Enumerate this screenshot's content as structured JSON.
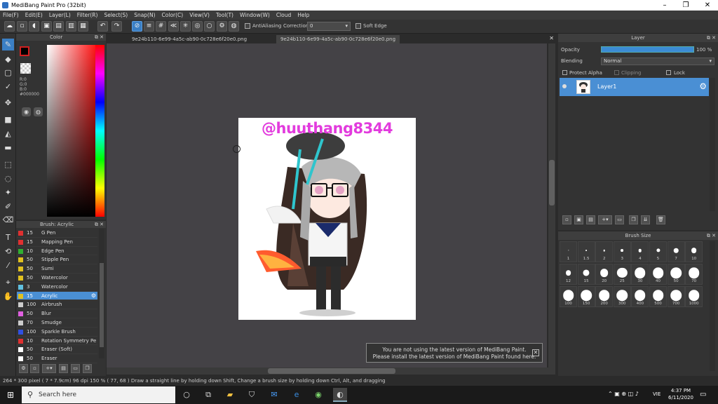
{
  "window": {
    "title": "MediBang Paint Pro (32bit)"
  },
  "menu": [
    "File(F)",
    "Edit(E)",
    "Layer(L)",
    "Filter(R)",
    "Select(S)",
    "Snap(N)",
    "Color(C)",
    "View(V)",
    "Tool(T)",
    "Window(W)",
    "Cloud",
    "Help"
  ],
  "toolbar": {
    "antialiasing": "AntiAliasing",
    "correction": "Correction",
    "correction_value": "0",
    "soft_edge": "Soft Edge"
  },
  "color_panel": {
    "title": "Color",
    "rgb": "R:0\nG:0\nB:0\n#000000",
    "fg_color": "#000000"
  },
  "brush_panel": {
    "title": "Brush: Acrylic",
    "items": [
      {
        "size": "15",
        "name": "G Pen",
        "color": "#e03030"
      },
      {
        "size": "15",
        "name": "Mapping Pen",
        "color": "#e03030"
      },
      {
        "size": "10",
        "name": "Edge Pen",
        "color": "#30b030"
      },
      {
        "size": "50",
        "name": "Stipple Pen",
        "color": "#e0c020"
      },
      {
        "size": "50",
        "name": "Sumi",
        "color": "#e0c020"
      },
      {
        "size": "50",
        "name": "Watercolor",
        "color": "#e0c020"
      },
      {
        "size": "3",
        "name": "Watercolor",
        "color": "#60c0e0"
      },
      {
        "size": "15",
        "name": "Acrylic",
        "color": "#e0c020",
        "selected": true
      },
      {
        "size": "100",
        "name": "Airbrush",
        "color": "#cccccc"
      },
      {
        "size": "50",
        "name": "Blur",
        "color": "#e060e0"
      },
      {
        "size": "70",
        "name": "Smudge",
        "color": "#cccccc"
      },
      {
        "size": "100",
        "name": "Sparkle Brush",
        "color": "#3050e0"
      },
      {
        "size": "10",
        "name": "Rotation Symmetry Pe",
        "color": "#e03030"
      },
      {
        "size": "50",
        "name": "Eraser (Soft)",
        "color": "#ffffff"
      },
      {
        "size": "50",
        "name": "Eraser",
        "color": "#ffffff"
      }
    ]
  },
  "tabs": [
    "9e24b110-6e99-4a5c-ab90-0c728e6f20e0.png",
    "9e24b110-6e99-4a5c-ab90-0c728e6f20e0.png"
  ],
  "canvas": {
    "watermark": "@huuthang8344"
  },
  "notice": {
    "line1": "You are not using the latest version of MediBang Paint.",
    "line2": "Please install the latest version of MediBang Paint found here."
  },
  "layer_panel": {
    "title": "Layer",
    "opacity_label": "Opacity",
    "opacity_value": "100 %",
    "opacity": 1.0,
    "blending_label": "Blending",
    "blending_value": "Normal",
    "protect_alpha": "Protect Alpha",
    "clipping": "Clipping",
    "lock": "Lock",
    "layer_name": "Layer1"
  },
  "brush_size": {
    "title": "Brush Size",
    "sizes": [
      "1",
      "1.5",
      "2",
      "3",
      "4",
      "5",
      "7",
      "10",
      "12",
      "15",
      "20",
      "25",
      "30",
      "40",
      "50",
      "70",
      "100",
      "150",
      "200",
      "300",
      "400",
      "500",
      "700",
      "1000"
    ]
  },
  "status": "264 * 300 pixel   ( 7 * 7.9cm)   96 dpi   150 %   ( 77, 68 )   Draw a straight line by holding down Shift, Change a brush size by holding down Ctrl, Alt, and dragging",
  "taskbar": {
    "search": "Search here",
    "lang": "VIE",
    "time": "4:37 PM",
    "date": "6/11/2020"
  }
}
